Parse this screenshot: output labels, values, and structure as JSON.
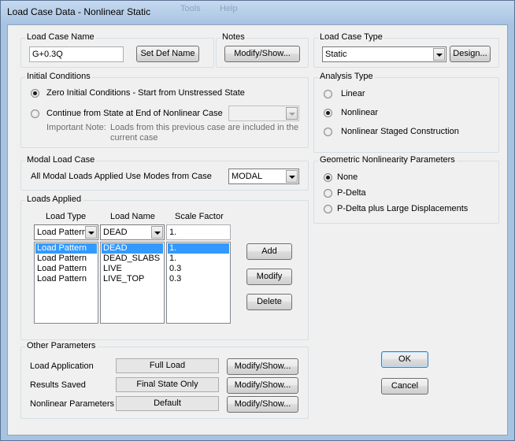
{
  "window": {
    "title": "Load Case Data - Nonlinear Static",
    "background_menu": [
      "Tools",
      "Help"
    ]
  },
  "load_case_name": {
    "legend": "Load Case Name",
    "value": "G+0.3Q",
    "set_def_button": "Set Def Name"
  },
  "notes": {
    "legend": "Notes",
    "button": "Modify/Show..."
  },
  "load_case_type": {
    "legend": "Load Case Type",
    "value": "Static",
    "button": "Design..."
  },
  "initial_conditions": {
    "legend": "Initial Conditions",
    "option_zero": "Zero Initial Conditions - Start from Unstressed State",
    "option_continue": "Continue from State at End of Nonlinear Case",
    "continue_case_value": "",
    "note_label": "Important Note:",
    "note_text_1": "Loads from this previous case are included in the",
    "note_text_2": "current case",
    "selected": "zero"
  },
  "analysis_type": {
    "legend": "Analysis Type",
    "options": [
      "Linear",
      "Nonlinear",
      "Nonlinear Staged Construction"
    ],
    "selected": "Nonlinear"
  },
  "modal_load_case": {
    "legend": "Modal Load Case",
    "label": "All Modal Loads Applied Use Modes from Case",
    "value": "MODAL"
  },
  "geometric_nonlinearity": {
    "legend": "Geometric Nonlinearity Parameters",
    "options": [
      "None",
      "P-Delta",
      "P-Delta plus Large Displacements"
    ],
    "selected": "None"
  },
  "loads_applied": {
    "legend": "Loads Applied",
    "headers": {
      "load_type": "Load Type",
      "load_name": "Load Name",
      "scale_factor": "Scale Factor"
    },
    "edit_row": {
      "load_type": "Load Pattern",
      "load_name": "DEAD",
      "scale_factor": "1."
    },
    "rows": [
      {
        "load_type": "Load Pattern",
        "load_name": "DEAD",
        "scale_factor": "1.",
        "selected": true
      },
      {
        "load_type": "Load Pattern",
        "load_name": "DEAD_SLABS",
        "scale_factor": "1.",
        "selected": false
      },
      {
        "load_type": "Load Pattern",
        "load_name": "LIVE",
        "scale_factor": "0.3",
        "selected": false
      },
      {
        "load_type": "Load Pattern",
        "load_name": "LIVE_TOP",
        "scale_factor": "0.3",
        "selected": false
      }
    ],
    "buttons": {
      "add": "Add",
      "modify": "Modify",
      "delete": "Delete"
    }
  },
  "other_parameters": {
    "legend": "Other Parameters",
    "rows": [
      {
        "label": "Load Application",
        "value": "Full Load",
        "button": "Modify/Show..."
      },
      {
        "label": "Results Saved",
        "value": "Final State Only",
        "button": "Modify/Show..."
      },
      {
        "label": "Nonlinear Parameters",
        "value": "Default",
        "button": "Modify/Show..."
      }
    ]
  },
  "dialog_buttons": {
    "ok": "OK",
    "cancel": "Cancel"
  },
  "colors": {
    "selection": "#3399ff",
    "window_frame": "#a7c3e2",
    "dialog_bg": "#f0f0f0"
  }
}
